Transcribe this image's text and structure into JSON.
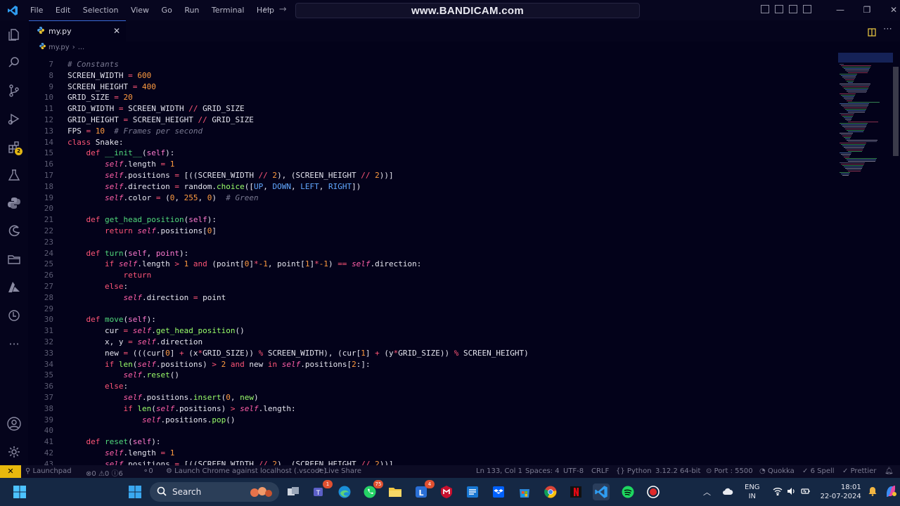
{
  "titlebar": {
    "menu": [
      "File",
      "Edit",
      "Selection",
      "View",
      "Go",
      "Run",
      "Terminal",
      "Help"
    ],
    "watermark": "www.BANDICAM.com"
  },
  "activity_bar": {
    "extensions_badge": "2"
  },
  "tab": {
    "label": "my.py",
    "close": "✕"
  },
  "breadcrumb": {
    "file": "my.py",
    "ellipsis": "..."
  },
  "statusbar": {
    "launchpad": "Launchpad",
    "errors": "0",
    "warnings": "0",
    "info": "6",
    "ports": "0",
    "launch": "Launch Chrome against localhost (.vscode)",
    "liveshare": "Live Share",
    "position": "Ln 133, Col 1",
    "spaces": "Spaces: 4",
    "encoding": "UTF-8",
    "eol": "CRLF",
    "language": "Python",
    "python_version": "3.12.2 64-bit",
    "port": "Port : 5500",
    "quokka": "Quokka",
    "spell": "6 Spell",
    "prettier": "Prettier"
  },
  "taskbar": {
    "search_label": "Search",
    "teams_badge": "1",
    "whatsapp_badge": "75",
    "l_badge": "4",
    "lang_top": "ENG",
    "lang_bottom": "IN",
    "time": "18:01",
    "date": "22-07-2024"
  },
  "editor": {
    "lines": [
      {
        "n": "7",
        "t": [
          [
            "c",
            "# Constants"
          ]
        ]
      },
      {
        "n": "8",
        "t": [
          [
            "",
            "SCREEN_WIDTH "
          ],
          [
            "o",
            "="
          ],
          [
            "n",
            " 600"
          ]
        ]
      },
      {
        "n": "9",
        "t": [
          [
            "",
            "SCREEN_HEIGHT "
          ],
          [
            "o",
            "="
          ],
          [
            "n",
            " 400"
          ]
        ]
      },
      {
        "n": "10",
        "t": [
          [
            "",
            "GRID_SIZE "
          ],
          [
            "o",
            "="
          ],
          [
            "n",
            " 20"
          ]
        ]
      },
      {
        "n": "11",
        "t": [
          [
            "",
            "GRID_WIDTH "
          ],
          [
            "o",
            "="
          ],
          [
            "",
            " SCREEN_WIDTH "
          ],
          [
            "o",
            "//"
          ],
          [
            "",
            " GRID_SIZE"
          ]
        ]
      },
      {
        "n": "12",
        "t": [
          [
            "",
            "GRID_HEIGHT "
          ],
          [
            "o",
            "="
          ],
          [
            "",
            " SCREEN_HEIGHT "
          ],
          [
            "o",
            "//"
          ],
          [
            "",
            " GRID_SIZE"
          ]
        ]
      },
      {
        "n": "13",
        "t": [
          [
            "",
            "FPS "
          ],
          [
            "o",
            "="
          ],
          [
            "n",
            " 10"
          ],
          [
            "",
            "  "
          ],
          [
            "c",
            "# Frames per second"
          ]
        ]
      },
      {
        "n": "14",
        "t": [
          [
            "k",
            "class"
          ],
          [
            "",
            " Snake:"
          ]
        ]
      },
      {
        "n": "15",
        "t": [
          [
            "",
            "    "
          ],
          [
            "k",
            "def"
          ],
          [
            "",
            " "
          ],
          [
            "f",
            "__init__"
          ],
          [
            "",
            "("
          ],
          [
            "pr",
            "self"
          ],
          [
            "",
            "):"
          ]
        ]
      },
      {
        "n": "16",
        "t": [
          [
            "",
            "        "
          ],
          [
            "s",
            "self"
          ],
          [
            "",
            ".length "
          ],
          [
            "o",
            "="
          ],
          [
            "n",
            " 1"
          ]
        ]
      },
      {
        "n": "17",
        "t": [
          [
            "",
            "        "
          ],
          [
            "s",
            "self"
          ],
          [
            "",
            ".positions "
          ],
          [
            "o",
            "="
          ],
          [
            "",
            " [(("
          ],
          [
            "",
            "SCREEN_WIDTH "
          ],
          [
            "o",
            "//"
          ],
          [
            "n",
            " 2"
          ],
          [
            "",
            "), (SCREEN_HEIGHT "
          ],
          [
            "o",
            "//"
          ],
          [
            "n",
            " 2"
          ],
          [
            "",
            "))]"
          ]
        ]
      },
      {
        "n": "18",
        "t": [
          [
            "",
            "        "
          ],
          [
            "s",
            "self"
          ],
          [
            "",
            ".direction "
          ],
          [
            "o",
            "="
          ],
          [
            "",
            " random."
          ],
          [
            "fu",
            "choice"
          ],
          [
            "",
            "(["
          ],
          [
            "p",
            "UP"
          ],
          [
            "",
            ", "
          ],
          [
            "p",
            "DOWN"
          ],
          [
            "",
            ", "
          ],
          [
            "p",
            "LEFT"
          ],
          [
            "",
            ", "
          ],
          [
            "p",
            "RIGHT"
          ],
          [
            "",
            "])"
          ]
        ]
      },
      {
        "n": "19",
        "t": [
          [
            "",
            "        "
          ],
          [
            "s",
            "self"
          ],
          [
            "",
            ".color "
          ],
          [
            "o",
            "="
          ],
          [
            "",
            " ("
          ],
          [
            "n",
            "0"
          ],
          [
            "",
            ", "
          ],
          [
            "n",
            "255"
          ],
          [
            "",
            ", "
          ],
          [
            "n",
            "0"
          ],
          [
            "",
            ")  "
          ],
          [
            "c",
            "# Green"
          ]
        ]
      },
      {
        "n": "20",
        "t": []
      },
      {
        "n": "21",
        "t": [
          [
            "",
            "    "
          ],
          [
            "k",
            "def"
          ],
          [
            "",
            " "
          ],
          [
            "f",
            "get_head_position"
          ],
          [
            "",
            "("
          ],
          [
            "pr",
            "self"
          ],
          [
            "",
            "):"
          ]
        ]
      },
      {
        "n": "22",
        "t": [
          [
            "",
            "        "
          ],
          [
            "k",
            "return"
          ],
          [
            "",
            " "
          ],
          [
            "s",
            "self"
          ],
          [
            "",
            ".positions["
          ],
          [
            "n",
            "0"
          ],
          [
            "",
            "]"
          ]
        ]
      },
      {
        "n": "23",
        "t": []
      },
      {
        "n": "24",
        "t": [
          [
            "",
            "    "
          ],
          [
            "k",
            "def"
          ],
          [
            "",
            " "
          ],
          [
            "f",
            "turn"
          ],
          [
            "",
            "("
          ],
          [
            "pr",
            "self"
          ],
          [
            "",
            ", "
          ],
          [
            "pr",
            "point"
          ],
          [
            "",
            "):"
          ]
        ]
      },
      {
        "n": "25",
        "t": [
          [
            "",
            "        "
          ],
          [
            "k",
            "if"
          ],
          [
            "",
            " "
          ],
          [
            "s",
            "self"
          ],
          [
            "",
            ".length "
          ],
          [
            "o",
            ">"
          ],
          [
            "n",
            " 1"
          ],
          [
            "",
            " "
          ],
          [
            "k",
            "and"
          ],
          [
            "",
            " (point["
          ],
          [
            "n",
            "0"
          ],
          [
            "",
            "]"
          ],
          [
            "o",
            "*"
          ],
          [
            "n",
            "-1"
          ],
          [
            "",
            ", point["
          ],
          [
            "n",
            "1"
          ],
          [
            "",
            "]"
          ],
          [
            "o",
            "*"
          ],
          [
            "n",
            "-1"
          ],
          [
            "",
            ") "
          ],
          [
            "o",
            "=="
          ],
          [
            "",
            " "
          ],
          [
            "s",
            "self"
          ],
          [
            "",
            ".direction:"
          ]
        ]
      },
      {
        "n": "26",
        "t": [
          [
            "",
            "            "
          ],
          [
            "k",
            "return"
          ]
        ]
      },
      {
        "n": "27",
        "t": [
          [
            "",
            "        "
          ],
          [
            "k",
            "else"
          ],
          [
            "",
            ":"
          ]
        ]
      },
      {
        "n": "28",
        "t": [
          [
            "",
            "            "
          ],
          [
            "s",
            "self"
          ],
          [
            "",
            ".direction "
          ],
          [
            "o",
            "="
          ],
          [
            "",
            " point"
          ]
        ]
      },
      {
        "n": "29",
        "t": []
      },
      {
        "n": "30",
        "t": [
          [
            "",
            "    "
          ],
          [
            "k",
            "def"
          ],
          [
            "",
            " "
          ],
          [
            "f",
            "move"
          ],
          [
            "",
            "("
          ],
          [
            "pr",
            "self"
          ],
          [
            "",
            "):"
          ]
        ]
      },
      {
        "n": "31",
        "t": [
          [
            "",
            "        cur "
          ],
          [
            "o",
            "="
          ],
          [
            "",
            " "
          ],
          [
            "s",
            "self"
          ],
          [
            "",
            "."
          ],
          [
            "fu",
            "get_head_position"
          ],
          [
            "",
            "()"
          ]
        ]
      },
      {
        "n": "32",
        "t": [
          [
            "",
            "        x, y "
          ],
          [
            "o",
            "="
          ],
          [
            "",
            " "
          ],
          [
            "s",
            "self"
          ],
          [
            "",
            ".direction"
          ]
        ]
      },
      {
        "n": "33",
        "t": [
          [
            "",
            "        new "
          ],
          [
            "o",
            "="
          ],
          [
            "",
            " (((cur["
          ],
          [
            "n",
            "0"
          ],
          [
            "",
            "] "
          ],
          [
            "o",
            "+"
          ],
          [
            "",
            " (x"
          ],
          [
            "o",
            "*"
          ],
          [
            "",
            "GRID_SIZE)) "
          ],
          [
            "o",
            "%"
          ],
          [
            "",
            " SCREEN_WIDTH), (cur["
          ],
          [
            "n",
            "1"
          ],
          [
            "",
            "] "
          ],
          [
            "o",
            "+"
          ],
          [
            "",
            " (y"
          ],
          [
            "o",
            "*"
          ],
          [
            "",
            "GRID_SIZE)) "
          ],
          [
            "o",
            "%"
          ],
          [
            "",
            " SCREEN_HEIGHT)"
          ]
        ]
      },
      {
        "n": "34",
        "t": [
          [
            "",
            "        "
          ],
          [
            "k",
            "if"
          ],
          [
            "",
            " "
          ],
          [
            "fu",
            "len"
          ],
          [
            "",
            "("
          ],
          [
            "s",
            "self"
          ],
          [
            "",
            ".positions) "
          ],
          [
            "o",
            ">"
          ],
          [
            "n",
            " 2"
          ],
          [
            "",
            " "
          ],
          [
            "k",
            "and"
          ],
          [
            "",
            " new "
          ],
          [
            "k",
            "in"
          ],
          [
            "",
            " "
          ],
          [
            "s",
            "self"
          ],
          [
            "",
            ".positions["
          ],
          [
            "n",
            "2"
          ],
          [
            "",
            ":]:"
          ]
        ]
      },
      {
        "n": "35",
        "t": [
          [
            "",
            "            "
          ],
          [
            "s",
            "self"
          ],
          [
            "",
            "."
          ],
          [
            "fu",
            "reset"
          ],
          [
            "",
            "()"
          ]
        ]
      },
      {
        "n": "36",
        "t": [
          [
            "",
            "        "
          ],
          [
            "k",
            "else"
          ],
          [
            "",
            ":"
          ]
        ]
      },
      {
        "n": "37",
        "t": [
          [
            "",
            "            "
          ],
          [
            "s",
            "self"
          ],
          [
            "",
            ".positions."
          ],
          [
            "fu",
            "insert"
          ],
          [
            "",
            "("
          ],
          [
            "n",
            "0"
          ],
          [
            "",
            ", "
          ],
          [
            "fu",
            "new"
          ],
          [
            "",
            ")"
          ]
        ]
      },
      {
        "n": "38",
        "t": [
          [
            "",
            "            "
          ],
          [
            "k",
            "if"
          ],
          [
            "",
            " "
          ],
          [
            "fu",
            "len"
          ],
          [
            "",
            "("
          ],
          [
            "s",
            "self"
          ],
          [
            "",
            ".positions) "
          ],
          [
            "o",
            ">"
          ],
          [
            "",
            " "
          ],
          [
            "s",
            "self"
          ],
          [
            "",
            ".length:"
          ]
        ]
      },
      {
        "n": "39",
        "t": [
          [
            "",
            "                "
          ],
          [
            "s",
            "self"
          ],
          [
            "",
            ".positions."
          ],
          [
            "fu",
            "pop"
          ],
          [
            "",
            "()"
          ]
        ]
      },
      {
        "n": "40",
        "t": []
      },
      {
        "n": "41",
        "t": [
          [
            "",
            "    "
          ],
          [
            "k",
            "def"
          ],
          [
            "",
            " "
          ],
          [
            "f",
            "reset"
          ],
          [
            "",
            "("
          ],
          [
            "pr",
            "self"
          ],
          [
            "",
            "):"
          ]
        ]
      },
      {
        "n": "42",
        "t": [
          [
            "",
            "        "
          ],
          [
            "s",
            "self"
          ],
          [
            "",
            ".length "
          ],
          [
            "o",
            "="
          ],
          [
            "n",
            " 1"
          ]
        ]
      },
      {
        "n": "43",
        "t": [
          [
            "",
            "        "
          ],
          [
            "s",
            "self"
          ],
          [
            "",
            ".positions "
          ],
          [
            "o",
            "="
          ],
          [
            "",
            " [((SCREEN_WIDTH "
          ],
          [
            "o",
            "//"
          ],
          [
            "n",
            " 2"
          ],
          [
            "",
            "), (SCREEN_HEIGHT "
          ],
          [
            "o",
            "//"
          ],
          [
            "n",
            " 2"
          ],
          [
            "",
            "))]"
          ]
        ]
      }
    ]
  }
}
